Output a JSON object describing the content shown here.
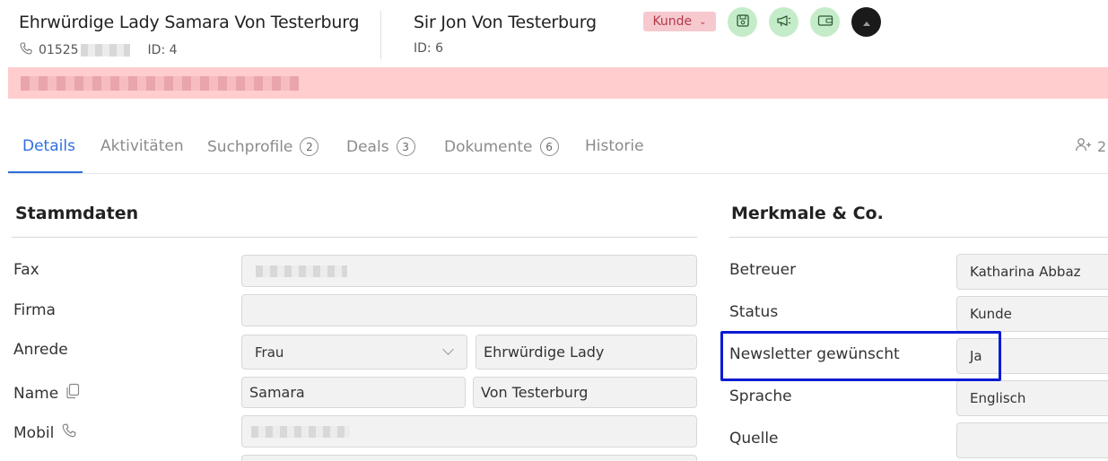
{
  "header": {
    "primary_name": "Ehrwürdige Lady Samara Von Testerburg",
    "phone_prefix": "01525",
    "primary_id": "ID: 4",
    "secondary_name": "Sir Jon Von Testerburg",
    "secondary_id": "ID: 6",
    "status_badge": "Kunde",
    "action_icons": [
      "save-icon",
      "megaphone-icon",
      "wallet-icon",
      "avatar"
    ]
  },
  "tabs": [
    {
      "label": "Details",
      "active": true
    },
    {
      "label": "Aktivitäten"
    },
    {
      "label": "Suchprofile",
      "count": "2"
    },
    {
      "label": "Deals",
      "count": "3"
    },
    {
      "label": "Dokumente",
      "count": "6"
    },
    {
      "label": "Historie"
    }
  ],
  "people_count": "2",
  "stammdaten": {
    "title": "Stammdaten",
    "fax_label": "Fax",
    "firma_label": "Firma",
    "anrede_label": "Anrede",
    "anrede_value": "Frau",
    "titel_value": "Ehrwürdige Lady",
    "name_label": "Name",
    "first_name": "Samara",
    "last_name": "Von Testerburg",
    "mobil_label": "Mobil"
  },
  "merkmale": {
    "title": "Merkmale & Co.",
    "betreuer_label": "Betreuer",
    "betreuer_value": "Katharina Abbaz",
    "status_label": "Status",
    "status_value": "Kunde",
    "newsletter_label": "Newsletter gewünscht",
    "newsletter_value": "Ja",
    "sprache_label": "Sprache",
    "sprache_value": "Englisch",
    "quelle_label": "Quelle"
  },
  "colors": {
    "accent": "#2f6fde",
    "alert_background": "#ffcdcd",
    "badge_background": "#f6c9cf",
    "action_background": "#c5ecc9",
    "highlight_border": "#0b1bd4"
  }
}
